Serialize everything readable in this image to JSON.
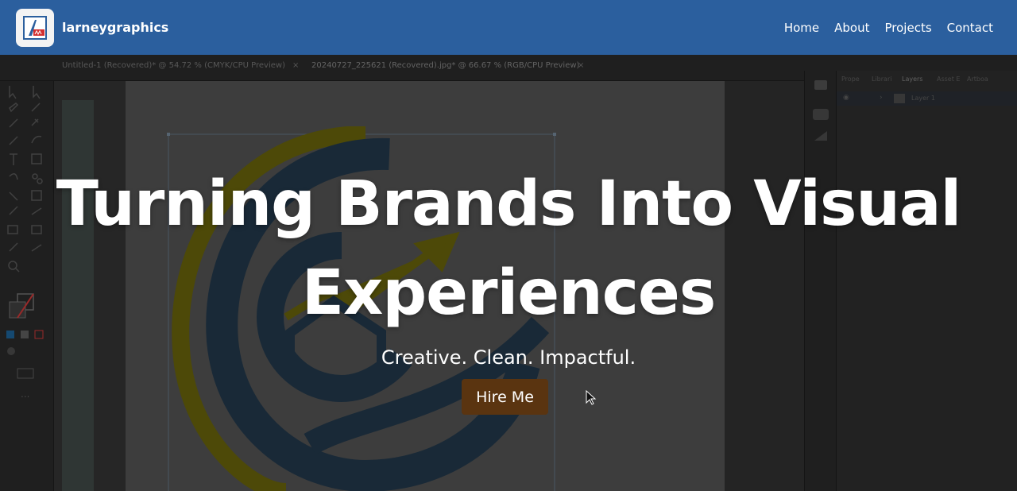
{
  "navbar": {
    "brand_name": "larneygraphics",
    "logo_icon": "brand-logo-icon",
    "links": [
      {
        "label": "Home"
      },
      {
        "label": "About"
      },
      {
        "label": "Projects"
      },
      {
        "label": "Contact"
      }
    ],
    "background_color": "#2b5f9e"
  },
  "hero": {
    "title_line1": "Turning Brands Into Visual",
    "title_line2": "Experiences",
    "subtitle": "Creative. Clean. Impactful.",
    "cta_label": "Hire Me",
    "cta_color": "#5a3410"
  },
  "background_app": {
    "tabs": [
      {
        "label": "Untitled-1 (Recovered)* @ 54.72 % (CMYK/CPU Preview)"
      },
      {
        "label": "20240727_225621 (Recovered).jpg* @ 66.67 % (RGB/CPU Preview)"
      }
    ],
    "panel_tabs": [
      "Prope",
      "Librari",
      "Layers",
      "Asset E",
      "Artboa"
    ],
    "layer_name": "Layer 1"
  }
}
